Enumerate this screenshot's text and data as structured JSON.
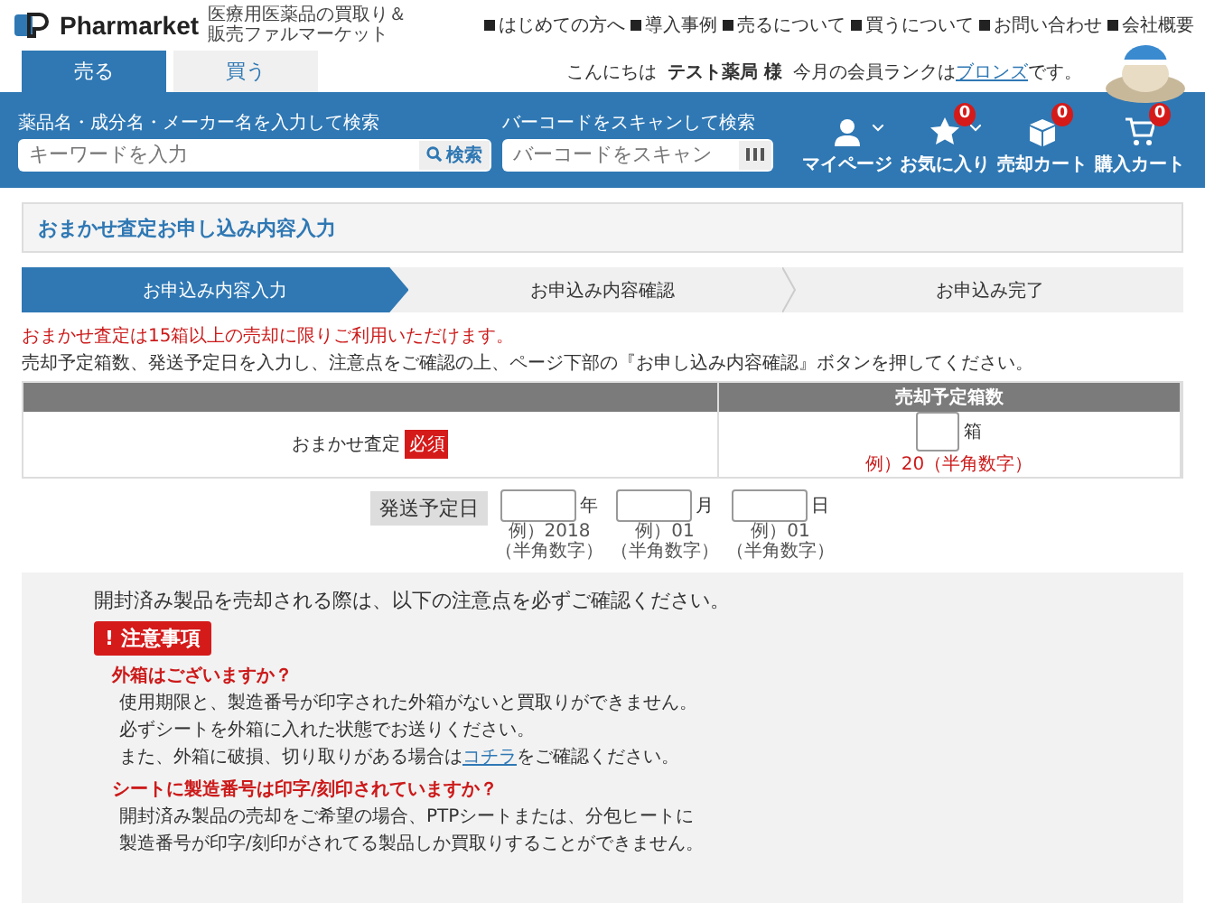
{
  "header": {
    "logo": "Pharmarket",
    "tagline": "医療用医薬品の買取り＆販売ファルマーケット",
    "nav": [
      "はじめての方へ",
      "導入事例",
      "売るについて",
      "買うについて",
      "お問い合わせ",
      "会社概要"
    ]
  },
  "tabs": [
    {
      "label": "売る",
      "selected": true
    },
    {
      "label": "買う",
      "selected": false
    }
  ],
  "greeting": {
    "hello": "こんにちは",
    "name": "テスト薬局",
    "honorific": "様",
    "rank_text": "今月の会員ランクは",
    "rank": "ブロンズ",
    "suffix": "です。"
  },
  "search": {
    "keyword_label": "薬品名・成分名・メーカー名を入力して検索",
    "keyword_placeholder": "キーワードを入力",
    "keyword_button": "検索",
    "barcode_label": "バーコードをスキャンして検索",
    "barcode_placeholder": "バーコードをスキャン"
  },
  "actions": [
    {
      "kind": "user",
      "label": "マイページ",
      "dropdown": true
    },
    {
      "kind": "star",
      "label": "お気に入り",
      "count": "0",
      "dropdown": true
    },
    {
      "kind": "box",
      "label": "売却カート",
      "count": "0",
      "dropdown": false
    },
    {
      "kind": "cart",
      "label": "購入カート",
      "count": "0",
      "dropdown": false
    }
  ],
  "page_title": "おまかせ査定お申し込み内容入力",
  "steps": [
    {
      "label": "お申込み内容入力",
      "selected": true
    },
    {
      "label": "お申込み内容確認",
      "selected": false
    },
    {
      "label": "お申込み完了",
      "selected": false
    }
  ],
  "notice": "おまかせ査定は15箱以上の売却に限りご利用いただけます。",
  "instructions": "売却予定箱数、発送予定日を入力し、注意点をご確認の上、ページ下部の『お申し込み内容確認』ボタンを押してください。",
  "table": {
    "column_2": "売却予定箱数",
    "label": "おまかせ査定",
    "required": "必須",
    "unit": "箱",
    "example": "例）20（半角数字）"
  },
  "ship_date": {
    "label": "発送予定日",
    "fields": [
      {
        "unit": "年",
        "example": "例）2018",
        "note": "（半角数字）"
      },
      {
        "unit": "月",
        "example": "例）01",
        "note": "（半角数字）"
      },
      {
        "unit": "日",
        "example": "例）01",
        "note": "（半角数字）"
      }
    ]
  },
  "caution": {
    "intro": "開封済み製品を売却される際は、以下の注意点を必ずご確認ください。",
    "mark": "!",
    "badge": "注意事項",
    "sections": [
      {
        "heading": "外箱はございますか？",
        "lines": [
          {
            "text": "使用期限と、製造番号が印字された外箱がないと買取りができません。"
          },
          {
            "text": "必ずシートを外箱に入れた状態でお送りください。"
          },
          {
            "text": "また、外箱に破損、切り取りがある場合は",
            "link": "コチラ",
            "after": "をご確認ください。"
          }
        ]
      },
      {
        "heading": "シートに製造番号は印字/刻印されていますか？",
        "lines": [
          {
            "text": "開封済み製品の売却をご希望の場合、PTPシートまたは、分包ヒートに"
          },
          {
            "text": "製造番号が印字/刻印がされてる製品しか買取りすることができません。"
          }
        ]
      }
    ]
  }
}
